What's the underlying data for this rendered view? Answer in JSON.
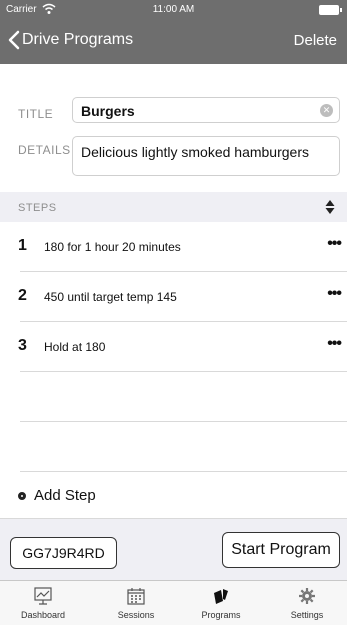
{
  "status_bar": {
    "carrier": "Carrier",
    "time": "11:00 AM"
  },
  "nav": {
    "back_label": "Drive Programs",
    "delete_label": "Delete"
  },
  "form": {
    "title_label": "TITLE",
    "title_value": "Burgers",
    "details_label": "DETAILS",
    "details_value": "Delicious lightly smoked hamburgers"
  },
  "steps_header": {
    "label": "STEPS"
  },
  "steps": [
    {
      "number": "1",
      "text": "180 for 1 hour 20 minutes",
      "more": "•••"
    },
    {
      "number": "2",
      "text": "450 until target temp 145",
      "more": "•••"
    },
    {
      "number": "3",
      "text": "Hold at 180",
      "more": "•••"
    }
  ],
  "add_step": {
    "label": "Add Step"
  },
  "bottom": {
    "code_label": "GG7J9R4RD",
    "start_label": "Start Program"
  },
  "tabs": [
    {
      "label": "Dashboard",
      "icon": "chart-icon"
    },
    {
      "label": "Sessions",
      "icon": "calendar-icon"
    },
    {
      "label": "Programs",
      "icon": "cards-icon"
    },
    {
      "label": "Settings",
      "icon": "gear-icon"
    }
  ]
}
